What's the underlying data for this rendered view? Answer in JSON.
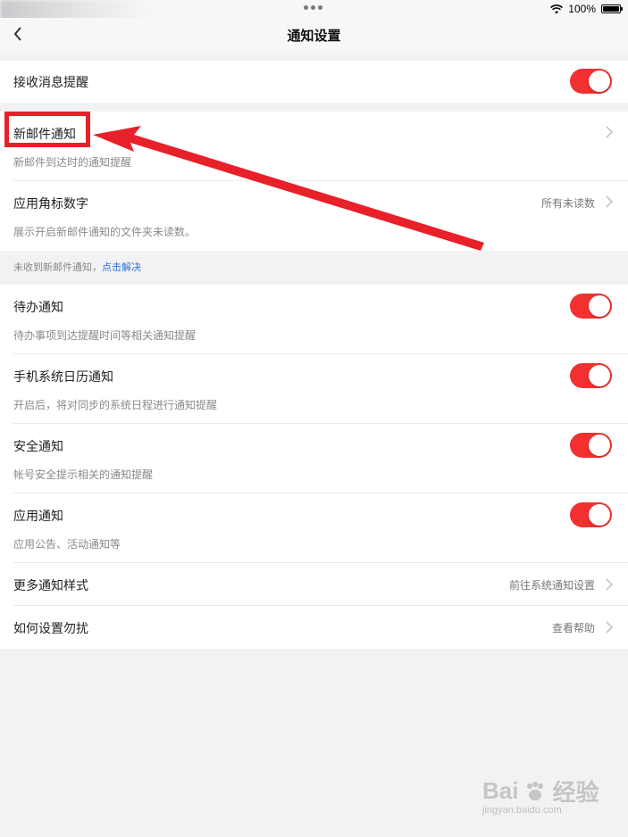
{
  "status_bar": {
    "battery_text": "100%"
  },
  "nav": {
    "title": "通知设置"
  },
  "rows": {
    "receive": {
      "title": "接收消息提醒",
      "toggle_on": true
    },
    "new_mail": {
      "title": "新邮件通知",
      "subtitle": "新邮件到达时的通知提醒"
    },
    "badge": {
      "title": "应用角标数字",
      "subtitle": "展示开启新邮件通知的文件夹未读数。",
      "value": "所有未读数"
    },
    "todo": {
      "title": "待办通知",
      "subtitle": "待办事项到达提醒时间等相关通知提醒",
      "toggle_on": true
    },
    "calendar": {
      "title": "手机系统日历通知",
      "subtitle": "开启后，将对同步的系统日程进行通知提醒",
      "toggle_on": true
    },
    "security": {
      "title": "安全通知",
      "subtitle": "帐号安全提示相关的通知提醒",
      "toggle_on": true
    },
    "app": {
      "title": "应用通知",
      "subtitle": "应用公告、活动通知等",
      "toggle_on": true
    },
    "more_styles": {
      "title": "更多通知样式",
      "value": "前往系统通知设置"
    },
    "dnd": {
      "title": "如何设置勿扰",
      "value": "查看帮助"
    }
  },
  "tip": {
    "text": "未收到新邮件通知，",
    "link": "点击解决"
  },
  "watermark": {
    "brand": "Bai",
    "brand_cn": "经验",
    "url": "jingyan.baidu.com"
  },
  "colors": {
    "toggle_on": "#f23030",
    "annotation": "#e8202a",
    "link": "#2b6ee0"
  }
}
